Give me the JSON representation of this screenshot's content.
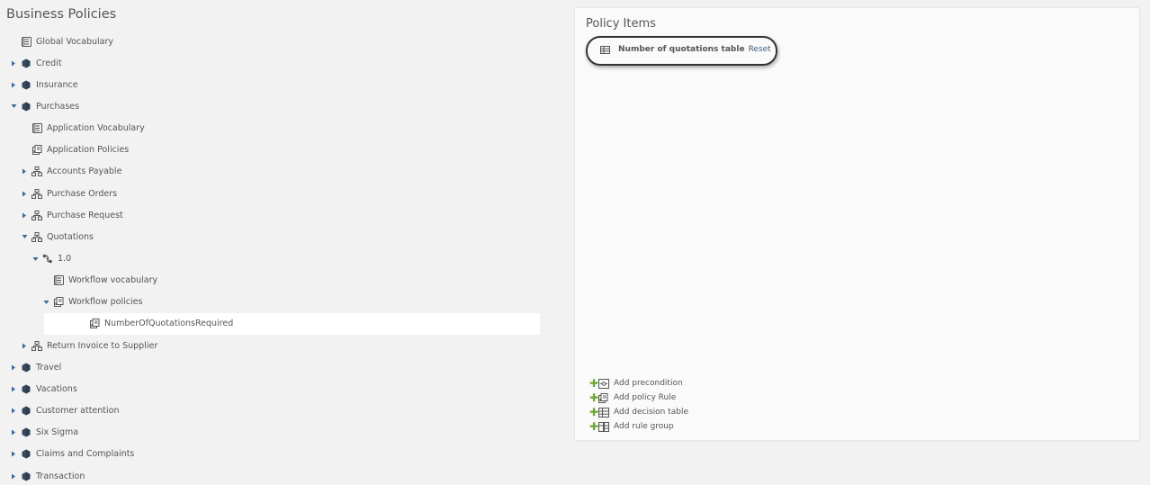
{
  "tree": {
    "title": "Business Policies",
    "nodes": [
      {
        "label": "Global Vocabulary",
        "icon": "vocabulary-icon",
        "depth": 0,
        "caret": "none"
      },
      {
        "label": "Credit",
        "icon": "category-icon",
        "depth": 0,
        "caret": "collapsed"
      },
      {
        "label": "Insurance",
        "icon": "category-icon",
        "depth": 0,
        "caret": "collapsed"
      },
      {
        "label": "Purchases",
        "icon": "category-icon",
        "depth": 0,
        "caret": "expanded"
      },
      {
        "label": "Application Vocabulary",
        "icon": "vocabulary-icon",
        "depth": 1,
        "caret": "none"
      },
      {
        "label": "Application Policies",
        "icon": "policies-icon",
        "depth": 1,
        "caret": "none"
      },
      {
        "label": "Accounts Payable",
        "icon": "process-icon",
        "depth": 1,
        "caret": "collapsed"
      },
      {
        "label": "Purchase Orders",
        "icon": "process-icon",
        "depth": 1,
        "caret": "collapsed"
      },
      {
        "label": "Purchase Request",
        "icon": "process-icon",
        "depth": 1,
        "caret": "collapsed"
      },
      {
        "label": "Quotations",
        "icon": "process-icon",
        "depth": 1,
        "caret": "expanded"
      },
      {
        "label": "1.0",
        "icon": "version-icon",
        "depth": 2,
        "caret": "expanded"
      },
      {
        "label": "Workflow vocabulary",
        "icon": "vocabulary-icon",
        "depth": 3,
        "caret": "none"
      },
      {
        "label": "Workflow policies",
        "icon": "policies-icon",
        "depth": 3,
        "caret": "expanded"
      },
      {
        "label": "NumberOfQuotationsRequired",
        "icon": "policies-icon",
        "depth": 4,
        "caret": "none",
        "selected": true
      },
      {
        "label": "Return Invoice to Supplier",
        "icon": "process-icon",
        "depth": 1,
        "caret": "collapsed"
      },
      {
        "label": "Travel",
        "icon": "category-icon",
        "depth": 0,
        "caret": "collapsed"
      },
      {
        "label": "Vacations",
        "icon": "category-icon",
        "depth": 0,
        "caret": "collapsed"
      },
      {
        "label": "Customer attention",
        "icon": "category-icon",
        "depth": 0,
        "caret": "collapsed"
      },
      {
        "label": "Six Sigma",
        "icon": "category-icon",
        "depth": 0,
        "caret": "collapsed"
      },
      {
        "label": "Claims and Complaints",
        "icon": "category-icon",
        "depth": 0,
        "caret": "collapsed"
      },
      {
        "label": "Transaction",
        "icon": "category-icon",
        "depth": 0,
        "caret": "collapsed"
      }
    ]
  },
  "panel": {
    "title": "Policy Items",
    "item": {
      "name": "Number of quotations table",
      "reset_label": "Reset",
      "icon": "decision-table-icon"
    },
    "actions": [
      {
        "label": "Add precondition",
        "icon": "precondition-icon"
      },
      {
        "label": "Add policy Rule",
        "icon": "policy-rule-icon"
      },
      {
        "label": "Add decision table",
        "icon": "decision-table-icon"
      },
      {
        "label": "Add rule group",
        "icon": "rule-group-icon"
      }
    ]
  },
  "colors": {
    "background": "#f2f2f2",
    "panel": "#fafafa",
    "selected_row": "#ffffff",
    "text": "#555555",
    "link": "#3d5c7a",
    "add_plus": "#6aa82f",
    "category_icon": "#34495e",
    "caret": "#3d6a96"
  }
}
